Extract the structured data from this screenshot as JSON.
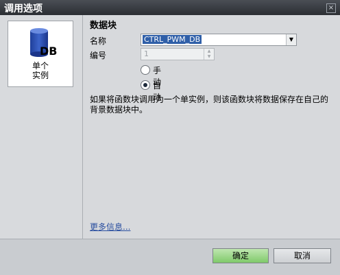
{
  "window": {
    "title": "调用选项",
    "close_glyph": "×"
  },
  "instance_tile": {
    "icon": "db-icon",
    "icon_text": "DB",
    "label_line1": "单个",
    "label_line2": "实例"
  },
  "data_block": {
    "section_title": "数据块",
    "name_label": "名称",
    "name_value": "CTRL_PWM_DB",
    "number_label": "编号",
    "number_value": "1",
    "radio_manual": "手动",
    "radio_auto": "自动",
    "selected": "自动"
  },
  "description": "如果将函数块调用为一个单实例，则该函数块将数据保存在自己的背景数据块中。",
  "more_info_link": "更多信息...",
  "buttons": {
    "ok": "确定",
    "cancel": "取消"
  },
  "colors": {
    "ok_button": "#8fd27a",
    "selection_highlight": "#2f5fa8",
    "link": "#2a4fa0"
  }
}
